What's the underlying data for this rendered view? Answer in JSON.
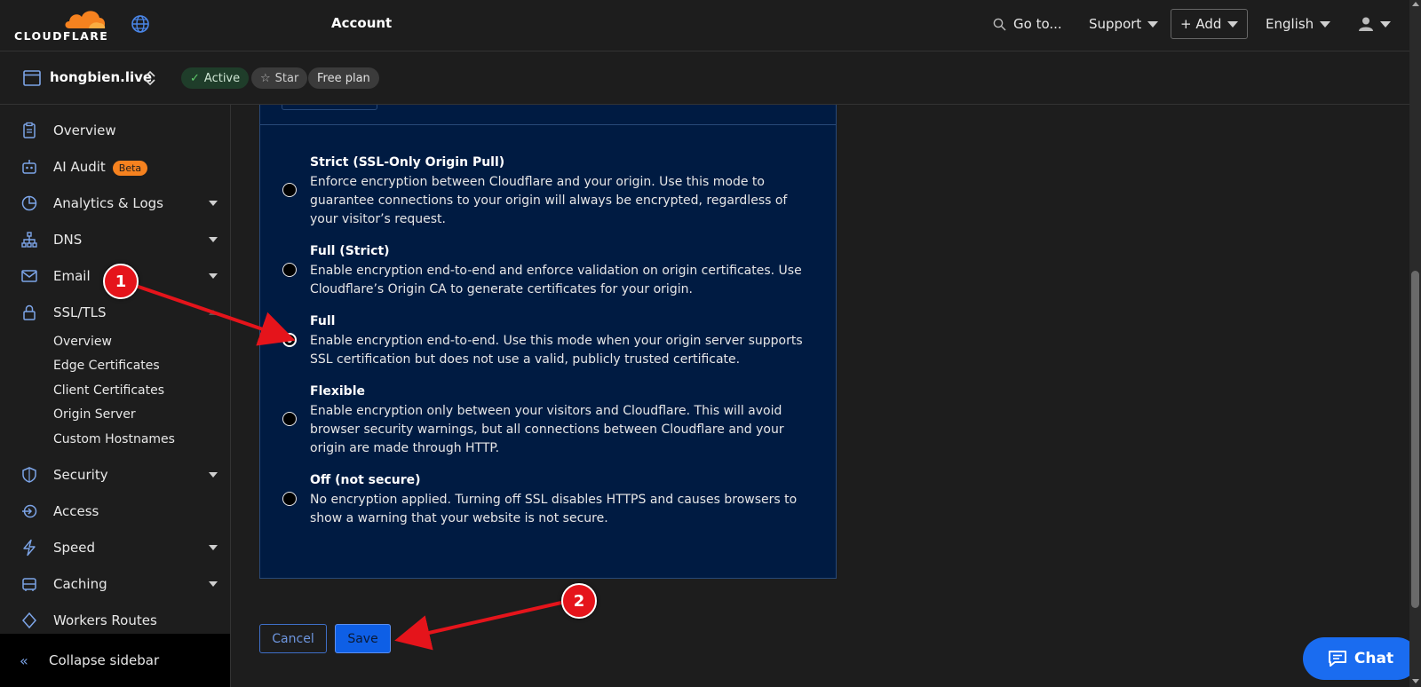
{
  "header": {
    "logo_text": "CLOUDFLARE",
    "account": "Account",
    "goto": "Go to...",
    "support": "Support",
    "add": "+ Add",
    "language": "English"
  },
  "zone": {
    "name": "hongbien.live",
    "status": "Active",
    "star": "Star",
    "plan": "Free plan"
  },
  "sidebar": {
    "items": [
      {
        "label": "Overview",
        "icon": "clipboard-icon"
      },
      {
        "label": "AI Audit",
        "icon": "robot-icon",
        "badge": "Beta"
      },
      {
        "label": "Analytics & Logs",
        "icon": "pie-chart-icon"
      },
      {
        "label": "DNS",
        "icon": "network-icon"
      },
      {
        "label": "Email",
        "icon": "envelope-icon"
      },
      {
        "label": "SSL/TLS",
        "icon": "lock-icon"
      },
      {
        "label": "Security",
        "icon": "shield-icon"
      },
      {
        "label": "Access",
        "icon": "access-icon"
      },
      {
        "label": "Speed",
        "icon": "lightning-icon"
      },
      {
        "label": "Caching",
        "icon": "database-icon"
      },
      {
        "label": "Workers Routes",
        "icon": "workers-icon"
      }
    ],
    "ssl_sub": [
      "Overview",
      "Edge Certificates",
      "Client Certificates",
      "Origin Server",
      "Custom Hostnames"
    ],
    "collapse": "Collapse sidebar"
  },
  "options": [
    {
      "title": "Strict (SSL-Only Origin Pull)",
      "desc": "Enforce encryption between Cloudflare and your origin. Use this mode to guarantee connections to your origin will always be encrypted, regardless of your visitor’s request.",
      "checked": false
    },
    {
      "title": "Full (Strict)",
      "desc": "Enable encryption end-to-end and enforce validation on origin certificates. Use Cloudflare’s Origin CA to generate certificates for your origin.",
      "checked": false
    },
    {
      "title": "Full",
      "desc": "Enable encryption end-to-end. Use this mode when your origin server supports SSL certification but does not use a valid, publicly trusted certificate.",
      "checked": true
    },
    {
      "title": "Flexible",
      "desc": "Enable encryption only between your visitors and Cloudflare. This will avoid browser security warnings, but all connections between Cloudflare and your origin are made through HTTP.",
      "checked": false
    },
    {
      "title": "Off (not secure)",
      "desc": "No encryption applied. Turning off SSL disables HTTPS and causes browsers to show a warning that your website is not secure.",
      "checked": false
    }
  ],
  "actions": {
    "cancel": "Cancel",
    "save": "Save"
  },
  "annotations": [
    "1",
    "2"
  ],
  "chat": "Chat",
  "colors": {
    "accent": "#0e5fe6",
    "panel": "#001b42",
    "annotation": "#e5141b",
    "brand": "#f6821f"
  }
}
